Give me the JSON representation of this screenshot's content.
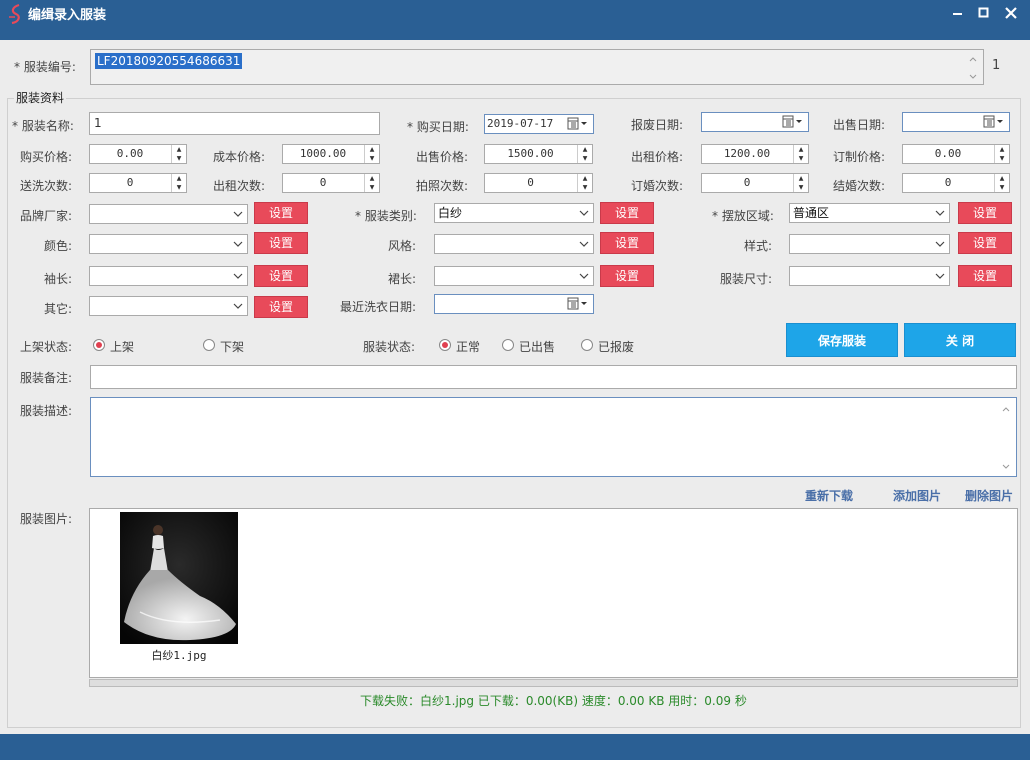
{
  "window": {
    "title": "编缉录入服装"
  },
  "fields": {
    "code_label": "* 服装编号:",
    "code_value": "LF20180920554686631",
    "code_count": "1",
    "group_caption": "服装资料",
    "name_label": "* 服装名称:",
    "name_value": "1",
    "buy_date_label": "* 购买日期:",
    "buy_date_value": "2019-07-17",
    "scrap_date_label": "报废日期:",
    "scrap_date_value": "",
    "sell_date_label": "出售日期:",
    "sell_date_value": "",
    "buy_price_label": "购买价格:",
    "buy_price_value": "0.00",
    "cost_price_label": "成本价格:",
    "cost_price_value": "1000.00",
    "sale_price_label": "出售价格:",
    "sale_price_value": "1500.00",
    "rent_price_label": "出租价格:",
    "rent_price_value": "1200.00",
    "custom_price_label": "订制价格:",
    "custom_price_value": "0.00",
    "wash_count_label": "送洗次数:",
    "wash_count_value": "0",
    "rent_count_label": "出租次数:",
    "rent_count_value": "0",
    "photo_count_label": "拍照次数:",
    "photo_count_value": "0",
    "engage_count_label": "订婚次数:",
    "engage_count_value": "0",
    "wedding_count_label": "结婚次数:",
    "wedding_count_value": "0",
    "brand_label": "品牌厂家:",
    "brand_value": "",
    "category_label": "* 服装类别:",
    "category_value": "白纱",
    "area_label": "* 摆放区域:",
    "area_value": "普通区",
    "color_label": "颜色:",
    "color_value": "",
    "style_label": "风格:",
    "style_value": "",
    "pattern_label": "样式:",
    "pattern_value": "",
    "sleeve_label": "袖长:",
    "sleeve_value": "",
    "skirt_label": "裙长:",
    "skirt_value": "",
    "size_label": "服装尺寸:",
    "size_value": "",
    "other_label": "其它:",
    "other_value": "",
    "last_wash_label": "最近洗衣日期:",
    "last_wash_value": "",
    "set_label": "设置",
    "shelf_label": "上架状态:",
    "shelf_on": "上架",
    "shelf_off": "下架",
    "state_label": "服装状态:",
    "state_normal": "正常",
    "state_sold": "已出售",
    "state_scrapped": "已报废",
    "remark_label": "服装备注:",
    "remark_value": "",
    "desc_label": "服装描述:",
    "desc_value": "",
    "image_label": "服装图片:"
  },
  "buttons": {
    "save": "保存服装",
    "close": "关 闭",
    "redownload": "重新下载",
    "add_image": "添加图片",
    "delete_image": "删除图片"
  },
  "images": [
    {
      "caption": "白纱1.jpg"
    }
  ],
  "status_text": "下载失败：白纱1.jpg  已下载：0.00(KB)  速度：0.00 KB 用时：0.09 秒",
  "state": {
    "shelf": "上架",
    "status": "正常"
  },
  "colors": {
    "titlebar": "#2a5f94",
    "set_button": "#e84a5a",
    "primary_button": "#1ea5e8",
    "status_text": "#2a8a2a",
    "link": "#4a6fa8"
  },
  "icons": {
    "logo": "app-logo-icon",
    "minimize": "minimize-icon",
    "maximize": "maximize-icon",
    "close": "close-icon",
    "calendar": "calendar-icon",
    "dropdown": "chevron-down-icon"
  }
}
